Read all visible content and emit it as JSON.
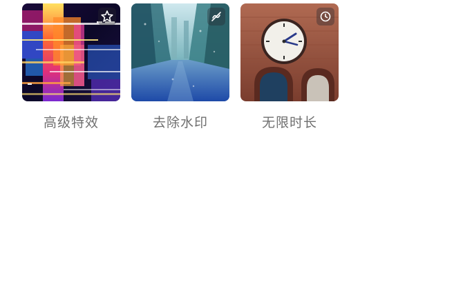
{
  "features": [
    {
      "label": "高级特效",
      "badge_icon": "sparkle-icon",
      "image": "glitch-art"
    },
    {
      "label": "去除水印",
      "badge_icon": "no-watermark-icon",
      "image": "city-street-rain"
    },
    {
      "label": "无限时长",
      "badge_icon": "timer-icon",
      "image": "clock-tower"
    }
  ]
}
